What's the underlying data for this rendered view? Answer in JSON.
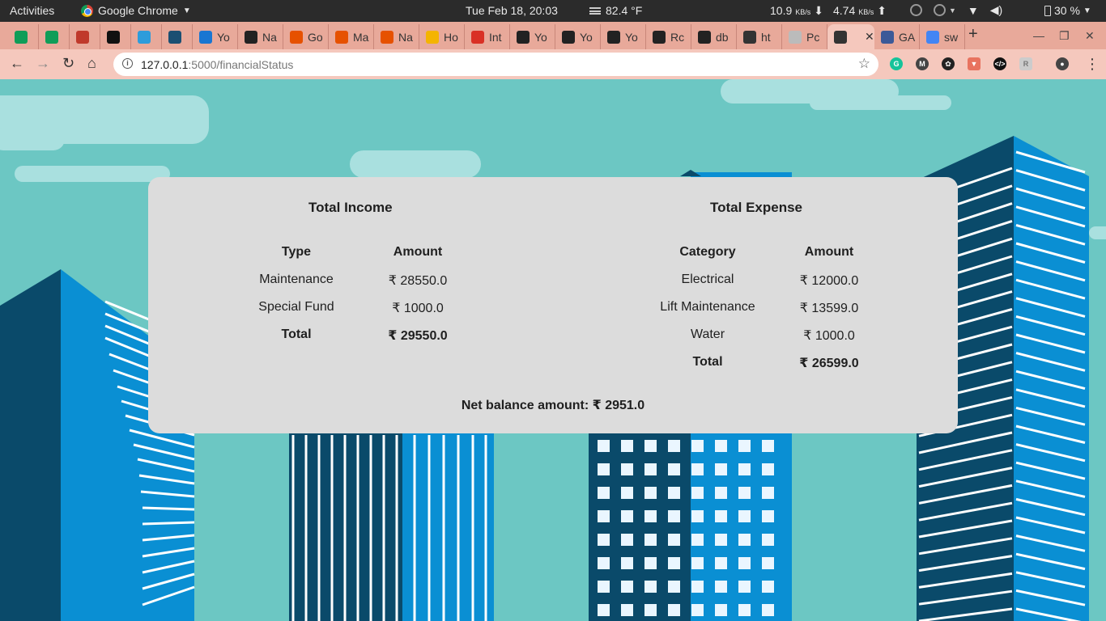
{
  "system_bar": {
    "activities": "Activities",
    "app_name": "Google Chrome",
    "clock": "Tue Feb 18, 20:03",
    "weather": "82.4 °F",
    "net_down_value": "10.9",
    "net_down_unit": "KB/s",
    "net_up_value": "4.74",
    "net_up_unit": "KB/s",
    "battery": "30 %"
  },
  "tabs": [
    {
      "label": "",
      "icon": "sheets-icon",
      "color": "#0f9d58"
    },
    {
      "label": "",
      "icon": "sheets-icon",
      "color": "#0f9d58"
    },
    {
      "label": "",
      "icon": "app-icon",
      "color": "#c0392b"
    },
    {
      "label": "",
      "icon": "a2-icon",
      "color": "#111111"
    },
    {
      "label": "",
      "icon": "pi-icon",
      "color": "#2d9cdb"
    },
    {
      "label": "",
      "icon": "tds-icon",
      "color": "#1b4f72"
    },
    {
      "label": "Yo",
      "icon": "s-icon",
      "color": "#1976d2"
    },
    {
      "label": "Na",
      "icon": "github-icon",
      "color": "#222222"
    },
    {
      "label": "Go",
      "icon": "ndn-icon",
      "color": "#e65100"
    },
    {
      "label": "Ma",
      "icon": "ndn-icon",
      "color": "#e65100"
    },
    {
      "label": "Na",
      "icon": "ndn-icon",
      "color": "#e65100"
    },
    {
      "label": "Ho",
      "icon": "smile-icon",
      "color": "#f4b400"
    },
    {
      "label": "Int",
      "icon": "gmail-icon",
      "color": "#d93025"
    },
    {
      "label": "Yo",
      "icon": "github-icon",
      "color": "#222222"
    },
    {
      "label": "Yo",
      "icon": "github-icon",
      "color": "#222222"
    },
    {
      "label": "Yo",
      "icon": "github-icon",
      "color": "#222222"
    },
    {
      "label": "Rc",
      "icon": "github-icon",
      "color": "#222222"
    },
    {
      "label": "db",
      "icon": "github-icon",
      "color": "#222222"
    },
    {
      "label": "ht",
      "icon": "globe-icon",
      "color": "#333333"
    },
    {
      "label": "Pc",
      "icon": "cube-icon",
      "color": "#bbbbbb"
    },
    {
      "label": "",
      "icon": "globe-icon",
      "color": "#333333",
      "active": true
    },
    {
      "label": "GA",
      "icon": "facebook-icon",
      "color": "#3b5998"
    },
    {
      "label": "sw",
      "icon": "google-icon",
      "color": "#4285f4"
    }
  ],
  "address_bar": {
    "url_host": "127.0.0.1",
    "url_path": ":5000/financialStatus"
  },
  "income": {
    "title": "Total Income",
    "headers": [
      "Type",
      "Amount"
    ],
    "rows": [
      [
        "Maintenance",
        "₹ 28550.0"
      ],
      [
        "Special Fund",
        "₹ 1000.0"
      ]
    ],
    "total_label": "Total",
    "total_value": "₹ 29550.0"
  },
  "expense": {
    "title": "Total Expense",
    "headers": [
      "Category",
      "Amount"
    ],
    "rows": [
      [
        "Electrical",
        "₹ 12000.0"
      ],
      [
        "Lift Maintenance",
        "₹ 13599.0"
      ],
      [
        "Water",
        "₹ 1000.0"
      ]
    ],
    "total_label": "Total",
    "total_value": "₹ 26599.0"
  },
  "net_balance": "Net balance amount: ₹ 2951.0"
}
